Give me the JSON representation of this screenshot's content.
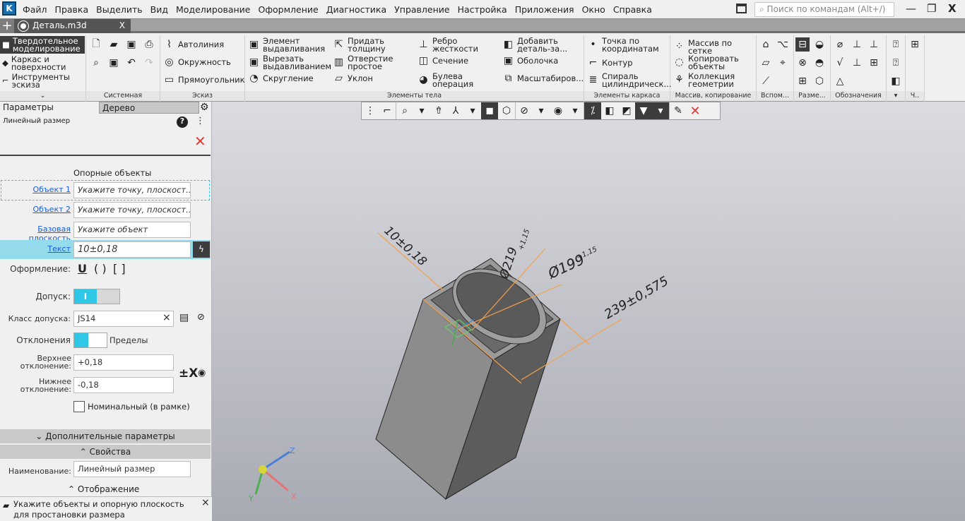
{
  "app": {
    "logo": "K"
  },
  "menu": [
    "Файл",
    "Правка",
    "Выделить",
    "Вид",
    "Моделирование",
    "Оформление",
    "Диагностика",
    "Управление",
    "Настройка",
    "Приложения",
    "Окно",
    "Справка"
  ],
  "search": {
    "placeholder": "Поиск по командам (Alt+/)"
  },
  "window": {
    "minimize": "—",
    "restore": "❐",
    "close": "X"
  },
  "tabs": {
    "new": "+",
    "doc": "Деталь.m3d",
    "close": "X"
  },
  "modes": [
    "Твердотельное\nмоделирование",
    "Каркас и\nповерхности",
    "Инструменты\nэскиза"
  ],
  "modes_expand": "⌄",
  "groups": {
    "system": "Системная",
    "sketch": "Эскиз",
    "body": "Элементы тела",
    "frame": "Элементы каркаса",
    "array": "Массив, копирование",
    "aux": "Вспом...",
    "dim": "Разме...",
    "marks": "Обозначения",
    "more": "Ч.."
  },
  "sketch_items": [
    "Автолиния",
    "Окружность",
    "Прямоугольник"
  ],
  "body_items": [
    "Элемент\nвыдавливания",
    "Вырезать\nвыдавливанием",
    "Скругление",
    "Придать\nтолщину",
    "Отверстие\nпростое",
    "Уклон",
    "Ребро\nжесткости",
    "Сечение",
    "Булева\nоперация",
    "Добавить\nдеталь-за...",
    "Оболочка",
    "Масштабиров..."
  ],
  "frame_items": [
    "Точка по\nкоординатам",
    "Контур",
    "Спираль\nцилиндрическ..."
  ],
  "array_items": [
    "Массив по сетке",
    "Копировать\nобъекты",
    "Коллекция\nгеометрии"
  ],
  "panel": {
    "tab_params": "Параметры",
    "tab_tree": "Дерево",
    "settings_icon": "⚙",
    "title": "Линейный размер",
    "section_ref": "Опорные объекты",
    "object1_label": "Объект 1",
    "object1_value": "Укажите точку, плоскост...",
    "object2_label": "Объект 2",
    "object2_value": "Укажите точку, плоскост...",
    "base_label": "Базовая плоскость",
    "base_value": "Укажите объект",
    "text_label": "Текст",
    "text_value": "10±0,18",
    "format_label": "Оформление:",
    "format_opts": [
      "U",
      "( )",
      "[ ]"
    ],
    "tolerance_label": "Допуск:",
    "tolerance_on": "I",
    "class_label": "Класс допуска:",
    "class_value": "JS14",
    "deviations_label": "Отклонения",
    "limits_label": "Пределы",
    "upper_label": "Верхнее\nотклонение:",
    "upper_value": "+0,18",
    "lower_label": "Нижнее\nотклонение:",
    "lower_value": "-0,18",
    "pm_icon": "±X",
    "nominal_label": "Номинальный (в рамке)",
    "extra_section": "Дополнительные параметры",
    "props_section": "Свойства",
    "name_label": "Наименование:",
    "name_value": "Линейный размер",
    "display_section": "Отображение"
  },
  "status": {
    "message": "Укажите объекты и опорную плоскость для простановки размера",
    "close": "×"
  },
  "model": {
    "dims": [
      "10±0,18",
      "Ø219",
      "+1,15",
      "Ø199",
      "+1,15",
      "239±0,575"
    ],
    "axes": [
      "Z",
      "Y",
      "X"
    ]
  },
  "colors": {
    "accent": "#2ec8e6",
    "dim": "#f5a04a",
    "cancel": "#e53935"
  }
}
